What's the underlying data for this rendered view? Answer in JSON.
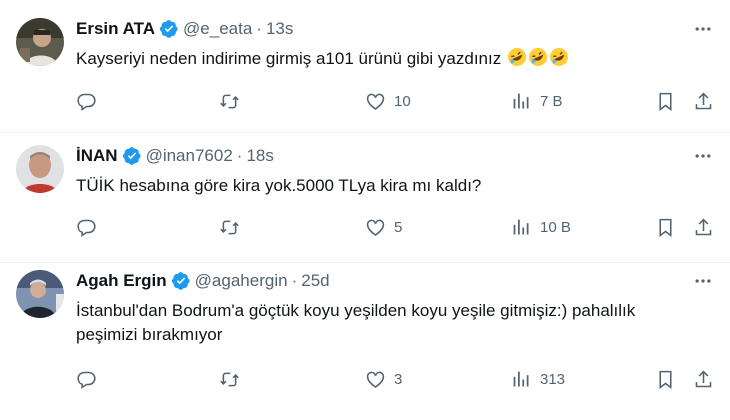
{
  "tweets": [
    {
      "name": "Ersin ATA",
      "handle": "@e_eata",
      "separator": "·",
      "time": "13s",
      "text": "Kayseriyi neden indirime girmiş a101 ürünü gibi yazdınız",
      "emoji": "rolling-on-floor-laughing x3",
      "replies": "",
      "reposts": "",
      "likes": "10",
      "views": "7 B"
    },
    {
      "name": "İNAN",
      "handle": "@inan7602",
      "separator": "·",
      "time": "18s",
      "text": "TÜİK hesabına göre kira yok.5000 TLya kira mı kaldı?",
      "replies": "",
      "reposts": "",
      "likes": "5",
      "views": "10 B"
    },
    {
      "name": "Agah Ergin",
      "handle": "@agahergin",
      "separator": "·",
      "time": "25d",
      "text_line1": "İstanbul'dan Bodrum'a göçtük koyu yeşilden koyu yeşile gitmişiz:) pahalılık",
      "text_line2": "peşimizi bırakmıyor",
      "replies": "",
      "reposts": "",
      "likes": "3",
      "views": "313"
    }
  ],
  "colors": {
    "verified": "#1d9bf0",
    "secondary_text": "#536471",
    "primary_text": "#0f1419",
    "divider": "#eff3f4"
  },
  "icons": [
    "verified-badge-icon",
    "more-icon",
    "reply-icon",
    "repost-icon",
    "like-icon",
    "views-icon",
    "bookmark-icon",
    "share-icon"
  ]
}
